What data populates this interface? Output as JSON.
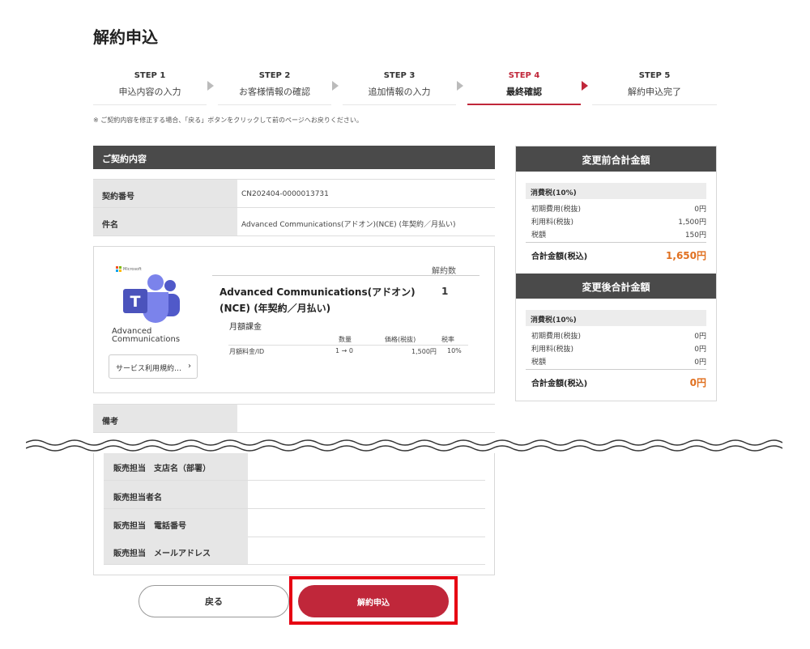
{
  "page_title": "解約申込",
  "steps": [
    {
      "num": "STEP 1",
      "label": "申込内容の入力"
    },
    {
      "num": "STEP 2",
      "label": "お客様情報の確認"
    },
    {
      "num": "STEP 3",
      "label": "追加情報の入力"
    },
    {
      "num": "STEP 4",
      "label": "最終確認"
    },
    {
      "num": "STEP 5",
      "label": "解約申込完了"
    }
  ],
  "active_step": 4,
  "note": "※ ご契約内容を修正する場合、「戻る」ボタンをクリックして前のページへお戻りください。",
  "contract": {
    "header": "ご契約内容",
    "rows": [
      {
        "key": "契約番号",
        "value": "CN202404-0000013731"
      },
      {
        "key": "件名",
        "value": "Advanced Communications(アドオン)(NCE) (年契約／月払い)"
      }
    ]
  },
  "product": {
    "vendor": "Microsoft",
    "icon_name": "microsoft-teams-icon",
    "icon_text": "Advanced Communications",
    "terms_button": "サービス利用規約…",
    "qty_header": "解約数",
    "name": "Advanced Communications(アドオン)(NCE) (年契約／月払い)",
    "qty": "1",
    "billing_type": "月額課金",
    "price_headers": {
      "qty": "数量",
      "price": "価格(税抜)",
      "tax": "税率"
    },
    "price_row": {
      "item": "月額料金/ID",
      "qty": "1 → 0",
      "price": "1,500円",
      "tax": "10%"
    }
  },
  "remarks": {
    "key": "備考",
    "value": ""
  },
  "sales": [
    {
      "key": "販売担当　支店名（部署）",
      "value": ""
    },
    {
      "key": "販売担当者名",
      "value": ""
    },
    {
      "key": "販売担当　電話番号",
      "value": ""
    },
    {
      "key": "販売担当　メールアドレス",
      "value": ""
    }
  ],
  "buttons": {
    "back": "戻る",
    "submit": "解約申込"
  },
  "summary_before": {
    "title": "変更前合計金額",
    "tax_label": "消費税(10%)",
    "rows": [
      {
        "label": "初期費用(税抜)",
        "amount": "0円"
      },
      {
        "label": "利用料(税抜)",
        "amount": "1,500円"
      },
      {
        "label": "税額",
        "amount": "150円"
      }
    ],
    "total_label": "合計金額(税込)",
    "total": "1,650円"
  },
  "summary_after": {
    "title": "変更後合計金額",
    "tax_label": "消費税(10%)",
    "rows": [
      {
        "label": "初期費用(税抜)",
        "amount": "0円"
      },
      {
        "label": "利用料(税抜)",
        "amount": "0円"
      },
      {
        "label": "税額",
        "amount": "0円"
      }
    ],
    "total_label": "合計金額(税込)",
    "total": "0円"
  },
  "colors": {
    "accent": "#c0273a",
    "highlight": "#e60012",
    "total_amount": "#e07020",
    "header_bg": "#4a4a4a"
  }
}
